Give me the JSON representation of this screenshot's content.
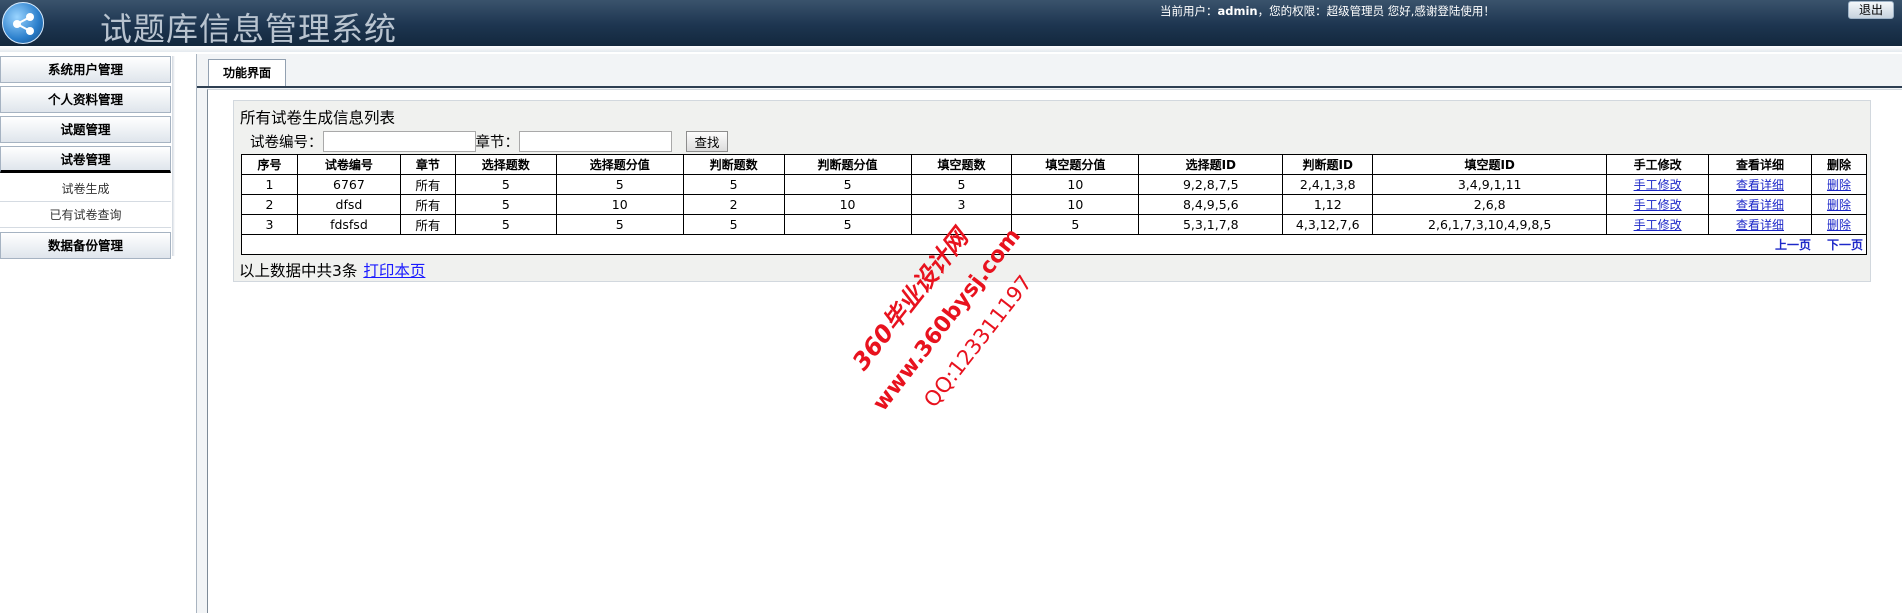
{
  "header": {
    "system_title": "试题库信息管理系统",
    "user_prefix": "当前用户：",
    "username": "admin",
    "role_text": "，您的权限：超级管理员 您好,感谢登陆使用！",
    "logout_label": "退出"
  },
  "sidebar": {
    "menus": [
      {
        "label": "系统用户管理"
      },
      {
        "label": "个人资料管理"
      },
      {
        "label": "试题管理"
      },
      {
        "label": "试卷管理"
      }
    ],
    "sub_items": [
      {
        "label": "试卷生成"
      },
      {
        "label": "已有试卷查询"
      }
    ],
    "last_menu": {
      "label": "数据备份管理"
    }
  },
  "main": {
    "tab_label": "功能界面",
    "panel_title": "所有试卷生成信息列表",
    "search": {
      "paper_no_label": "试卷编号：",
      "paper_no_value": "",
      "chapter_label": "章节：",
      "chapter_value": "",
      "button_label": "查找"
    },
    "table": {
      "headers": [
        "序号",
        "试卷编号",
        "章节",
        "选择题数",
        "选择题分值",
        "判断题数",
        "判断题分值",
        "填空题数",
        "填空题分值",
        "选择题ID",
        "判断题ID",
        "填空题ID",
        "手工修改",
        "查看详细",
        "删除"
      ],
      "rows": [
        {
          "no": "1",
          "paper": "6767",
          "chapter": "所有",
          "choice_count": "5",
          "choice_score": "5",
          "judge_count": "5",
          "judge_score": "5",
          "fill_count": "5",
          "fill_score": "10",
          "choice_ids": "9,2,8,7,5",
          "judge_ids": "2,4,1,3,8",
          "fill_ids": "3,4,9,1,11",
          "edit": "手工修改",
          "detail": "查看详细",
          "delete": "删除"
        },
        {
          "no": "2",
          "paper": "dfsd",
          "chapter": "所有",
          "choice_count": "5",
          "choice_score": "10",
          "judge_count": "2",
          "judge_score": "10",
          "fill_count": "3",
          "fill_score": "10",
          "choice_ids": "8,4,9,5,6",
          "judge_ids": "1,12",
          "fill_ids": "2,6,8",
          "edit": "手工修改",
          "detail": "查看详细",
          "delete": "删除"
        },
        {
          "no": "3",
          "paper": "fdsfsd",
          "chapter": "所有",
          "choice_count": "5",
          "choice_score": "5",
          "judge_count": "5",
          "judge_score": "5",
          "fill_count": "",
          "fill_score": "5",
          "choice_ids": "5,3,1,7,8",
          "judge_ids": "4,3,12,7,6",
          "fill_ids": "2,6,1,7,3,10,4,9,8,5",
          "edit": "手工修改",
          "detail": "查看详细",
          "delete": "删除"
        }
      ],
      "prev_page": "上一页",
      "next_page": "下一页"
    },
    "footer": {
      "count_text": "以上数据中共3条",
      "print_label": "打印本页"
    }
  },
  "watermark": {
    "line1": "360毕业设计网",
    "line2": "www.360bysj.com",
    "line3": "QQ:123311197",
    "color": "#e8121e"
  },
  "colors": {
    "header_bg": "#1d3550",
    "link": "#1d28c8"
  }
}
